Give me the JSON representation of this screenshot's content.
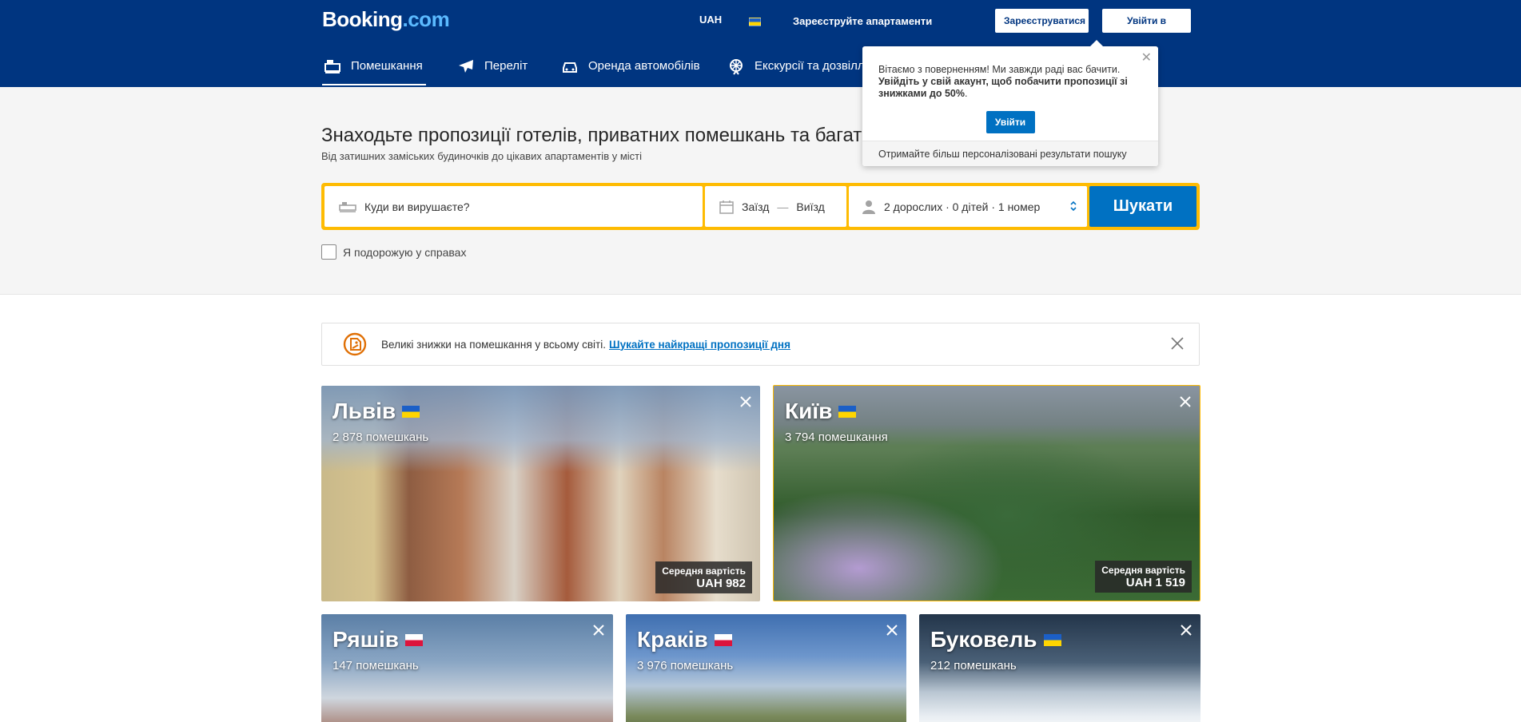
{
  "header": {
    "logo_main": "Booking",
    "logo_tld": ".com",
    "currency": "UAH",
    "list_property": "Зареєструйте апартаменти",
    "register": "Зареєструватися",
    "login": "Увійти в акаунт"
  },
  "nav": {
    "stays": "Помешкання",
    "flights": "Переліт",
    "cars": "Оренда автомобілів",
    "tours": "Екскурсії та дозвілля"
  },
  "popup": {
    "greeting": "Вітаємо з поверненням! Ми завжди раді вас бачити.",
    "cta_text": "Увійдіть у свій акаунт, щоб побачити пропозиції зі знижками до 50%",
    "cta_tail": ".",
    "button": "Увійти",
    "footer": "Отримайте більш персоналізовані результати пошуку"
  },
  "hero": {
    "title": "Знаходьте пропозиції готелів, приватних помешкань та багато іншого",
    "subtitle": "Від затишних заміських будиночків до цікавих апартаментів у місті"
  },
  "search": {
    "destination_placeholder": "Куди ви вирушаєте?",
    "checkin": "Заїзд",
    "dash": "—",
    "checkout": "Виїзд",
    "guests": "2 дорослих · 0 дітей · 1 номер",
    "button": "Шукати",
    "business_trip": "Я подорожую у справах"
  },
  "deal": {
    "text": "Великі знижки на помешкання у всьому світі.",
    "link": "Шукайте найкращі пропозиції дня"
  },
  "cards": [
    {
      "name": "Львів",
      "count": "2 878 помешкань",
      "price_label": "Середня вартість",
      "price": "UAH 982",
      "flag": "ua"
    },
    {
      "name": "Київ",
      "count": "3 794 помешкання",
      "price_label": "Середня вартість",
      "price": "UAH 1 519",
      "flag": "ua"
    },
    {
      "name": "Ряшів",
      "count": "147 помешкань",
      "flag": "pl"
    },
    {
      "name": "Краків",
      "count": "3 976 помешкань",
      "flag": "pl"
    },
    {
      "name": "Буковель",
      "count": "212 помешкань",
      "flag": "ua"
    }
  ],
  "colors": {
    "brand": "#003580",
    "accent": "#0071c2",
    "search_border": "#febb02"
  }
}
